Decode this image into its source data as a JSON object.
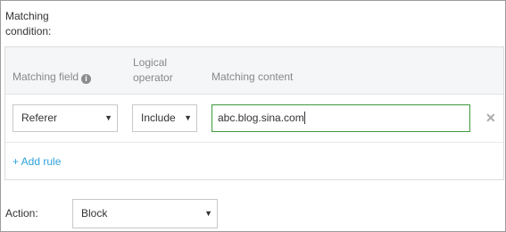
{
  "condition": {
    "label": "Matching condition:"
  },
  "rules": {
    "columns": {
      "field": "Matching field",
      "operator": "Logical operator",
      "content": "Matching content"
    },
    "row": {
      "field_value": "Referer",
      "operator_value": "Include",
      "content_value": "abc.blog.sina.com"
    },
    "add_label": "+ Add rule"
  },
  "action": {
    "label": "Action:",
    "value": "Block"
  },
  "icons": {
    "help": "help-info-icon",
    "remove": "close-icon",
    "caret": "caret-down-icon"
  }
}
